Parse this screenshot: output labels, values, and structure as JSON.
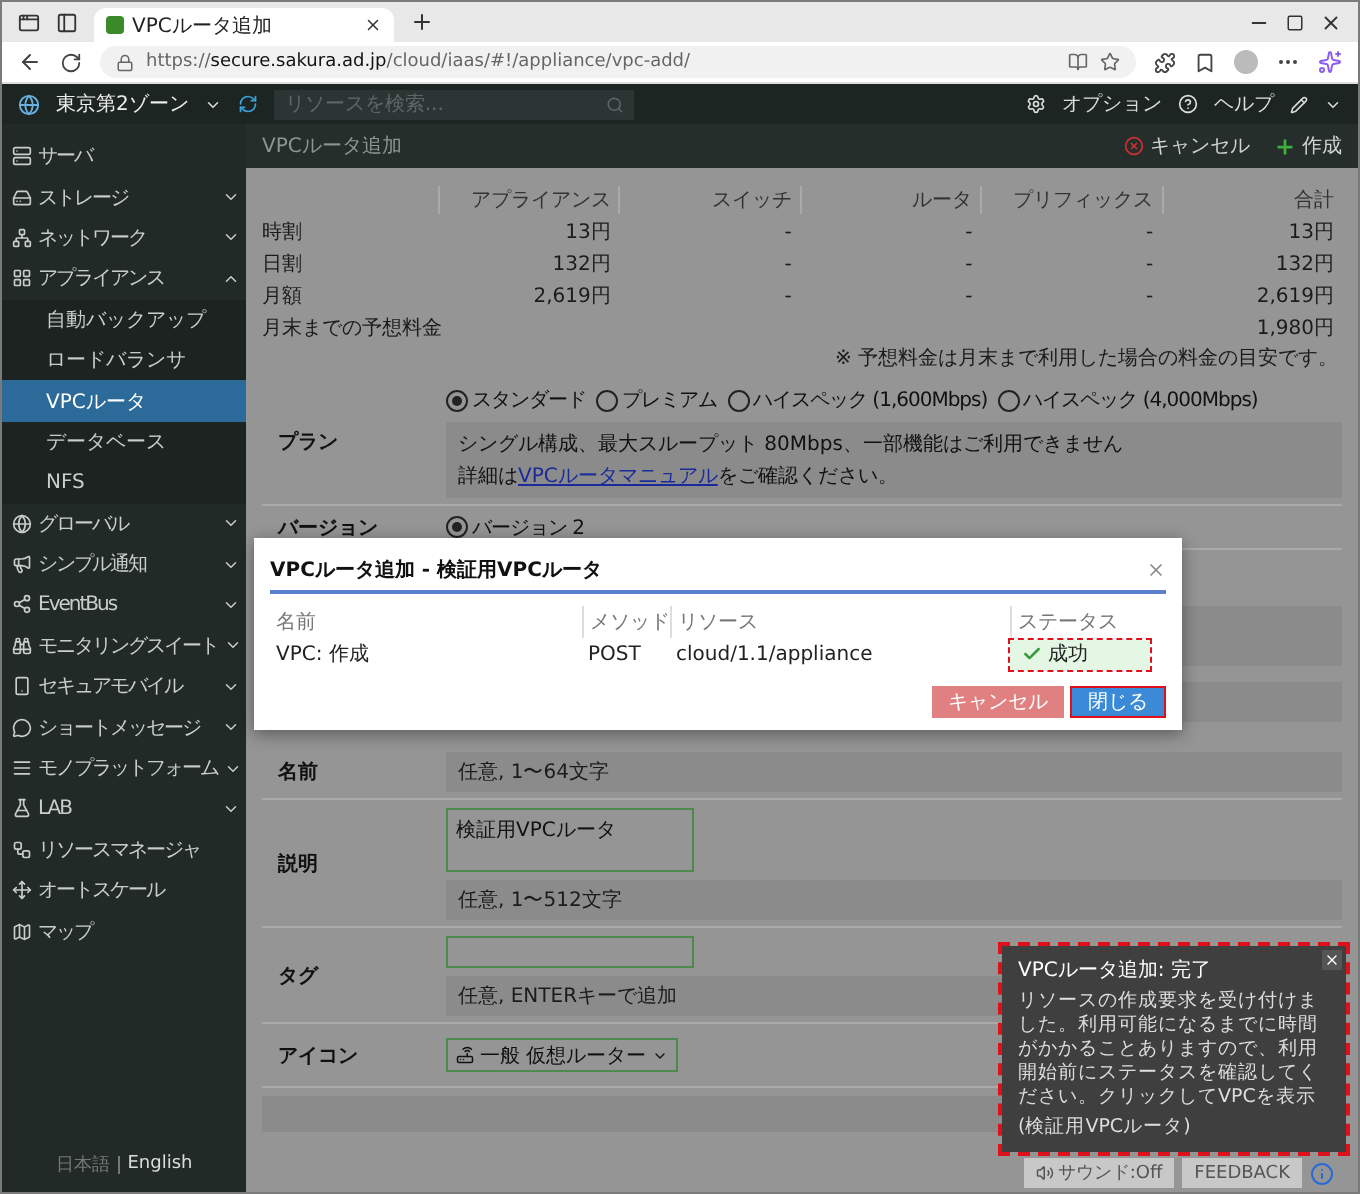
{
  "browser": {
    "tab_title": "VPCルータ追加",
    "url": "https://**secure.sakura.ad.jp**/cloud/iaas/#!/appliance/vpc-add/"
  },
  "topbar": {
    "zone": "東京第2ゾーン",
    "search_placeholder": "リソースを検索...",
    "links": [
      "オプション",
      "ヘルプ"
    ]
  },
  "sidebar": {
    "items": [
      {
        "label": "サーバ"
      },
      {
        "label": "ストレージ",
        "expanded": false
      },
      {
        "label": "ネットワーク",
        "expanded": false
      },
      {
        "label": "アプライアンス",
        "expanded": true,
        "children": [
          {
            "label": "自動バックアップ",
            "selected": false
          },
          {
            "label": "ロードバランサ",
            "selected": false
          },
          {
            "label": "VPCルータ",
            "selected": true
          },
          {
            "label": "データベース",
            "selected": false
          },
          {
            "label": "NFS",
            "selected": false
          }
        ]
      },
      {
        "label": "グローバル",
        "expanded": false
      },
      {
        "label": "シンプル通知",
        "expanded": false
      },
      {
        "label": "EventBus",
        "expanded": false
      },
      {
        "label": "モニタリングスイート",
        "expanded": false
      },
      {
        "label": "セキュアモバイル",
        "expanded": false
      },
      {
        "label": "ショートメッセージ",
        "expanded": false
      },
      {
        "label": "モノプラットフォーム",
        "expanded": false
      },
      {
        "label": "LAB",
        "expanded": false
      },
      {
        "label": "リソースマネージャ"
      },
      {
        "label": "オートスケール"
      },
      {
        "label": "マップ"
      }
    ],
    "languages": [
      "日本語",
      "English"
    ]
  },
  "page": {
    "title": "VPCルータ追加",
    "actions": [
      "キャンセル",
      "作成"
    ]
  },
  "pricing": {
    "columns": [
      "アプライアンス",
      "スイッチ",
      "ルータ",
      "プリフィックス",
      "合計"
    ],
    "rows": [
      {
        "label": "時割",
        "cells": [
          "13円",
          "-",
          "-",
          "-"
        ],
        "total": "13円"
      },
      {
        "label": "日割",
        "cells": [
          "132円",
          "-",
          "-",
          "-"
        ],
        "total": "132円"
      },
      {
        "label": "月額",
        "cells": [
          "2,619円",
          "-",
          "-",
          "-"
        ],
        "total": "2,619円"
      },
      {
        "label": "月末までの予想料金",
        "total": "1,980円"
      }
    ],
    "note": "※ 予想料金は月末まで利用した場合の料金の目安です。"
  },
  "form": {
    "rows": [
      {
        "kind": "radio",
        "label": "プラン",
        "options": [
          {
            "label": "スタンダード",
            "selected": true
          },
          {
            "label": "プレミアム",
            "selected": false
          },
          {
            "label": "ハイスペック (1,600Mbps)",
            "selected": false
          },
          {
            "label": "ハイスペック (4,000Mbps)",
            "selected": false
          }
        ],
        "info": "シングル構成、最大スループット 80Mbps、一部機能はご利用できません",
        "info_prefix": "詳細は",
        "info_link": "VPCルータマニュアル",
        "info_suffix": "をご確認ください。"
      },
      {
        "kind": "radio",
        "label": "バージョン",
        "options": [
          {
            "label": "バージョン 2",
            "selected": true
          }
        ]
      },
      {
        "kind": "covered"
      },
      {
        "kind": "hint",
        "label": "名前",
        "hint": "任意, 1〜64文字"
      },
      {
        "kind": "textarea",
        "label": "説明",
        "value": "検証用VPCルータ",
        "hint": "任意, 1〜512文字"
      },
      {
        "kind": "text",
        "label": "タグ",
        "hint": "任意, ENTERキーで追加"
      },
      {
        "kind": "select",
        "label": "アイコン",
        "value": "一般 仮想ルーター"
      },
      {
        "kind": "empty"
      }
    ]
  },
  "modal": {
    "title": "VPCルータ追加 - 検証用VPCルータ",
    "columns": [
      "名前",
      "メソッド",
      "リソース",
      "ステータス"
    ],
    "rows": [
      {
        "name": "VPC: 作成",
        "method": "POST",
        "resource": "cloud/1.1/appliance",
        "status": "成功"
      }
    ],
    "buttons": [
      "キャンセル",
      "閉じる"
    ]
  },
  "toast": {
    "title": "VPCルータ追加: 完了",
    "message": "リソースの作成要求を受け付けました。利用可能になるまでに時間がかかることありますので、利用開始前にステータスを確認してください。クリックしてVPCを表示",
    "detail": "(検証用VPCルータ)"
  },
  "footer": {
    "sound": "サウンド:Off",
    "feedback": "FEEDBACK"
  }
}
